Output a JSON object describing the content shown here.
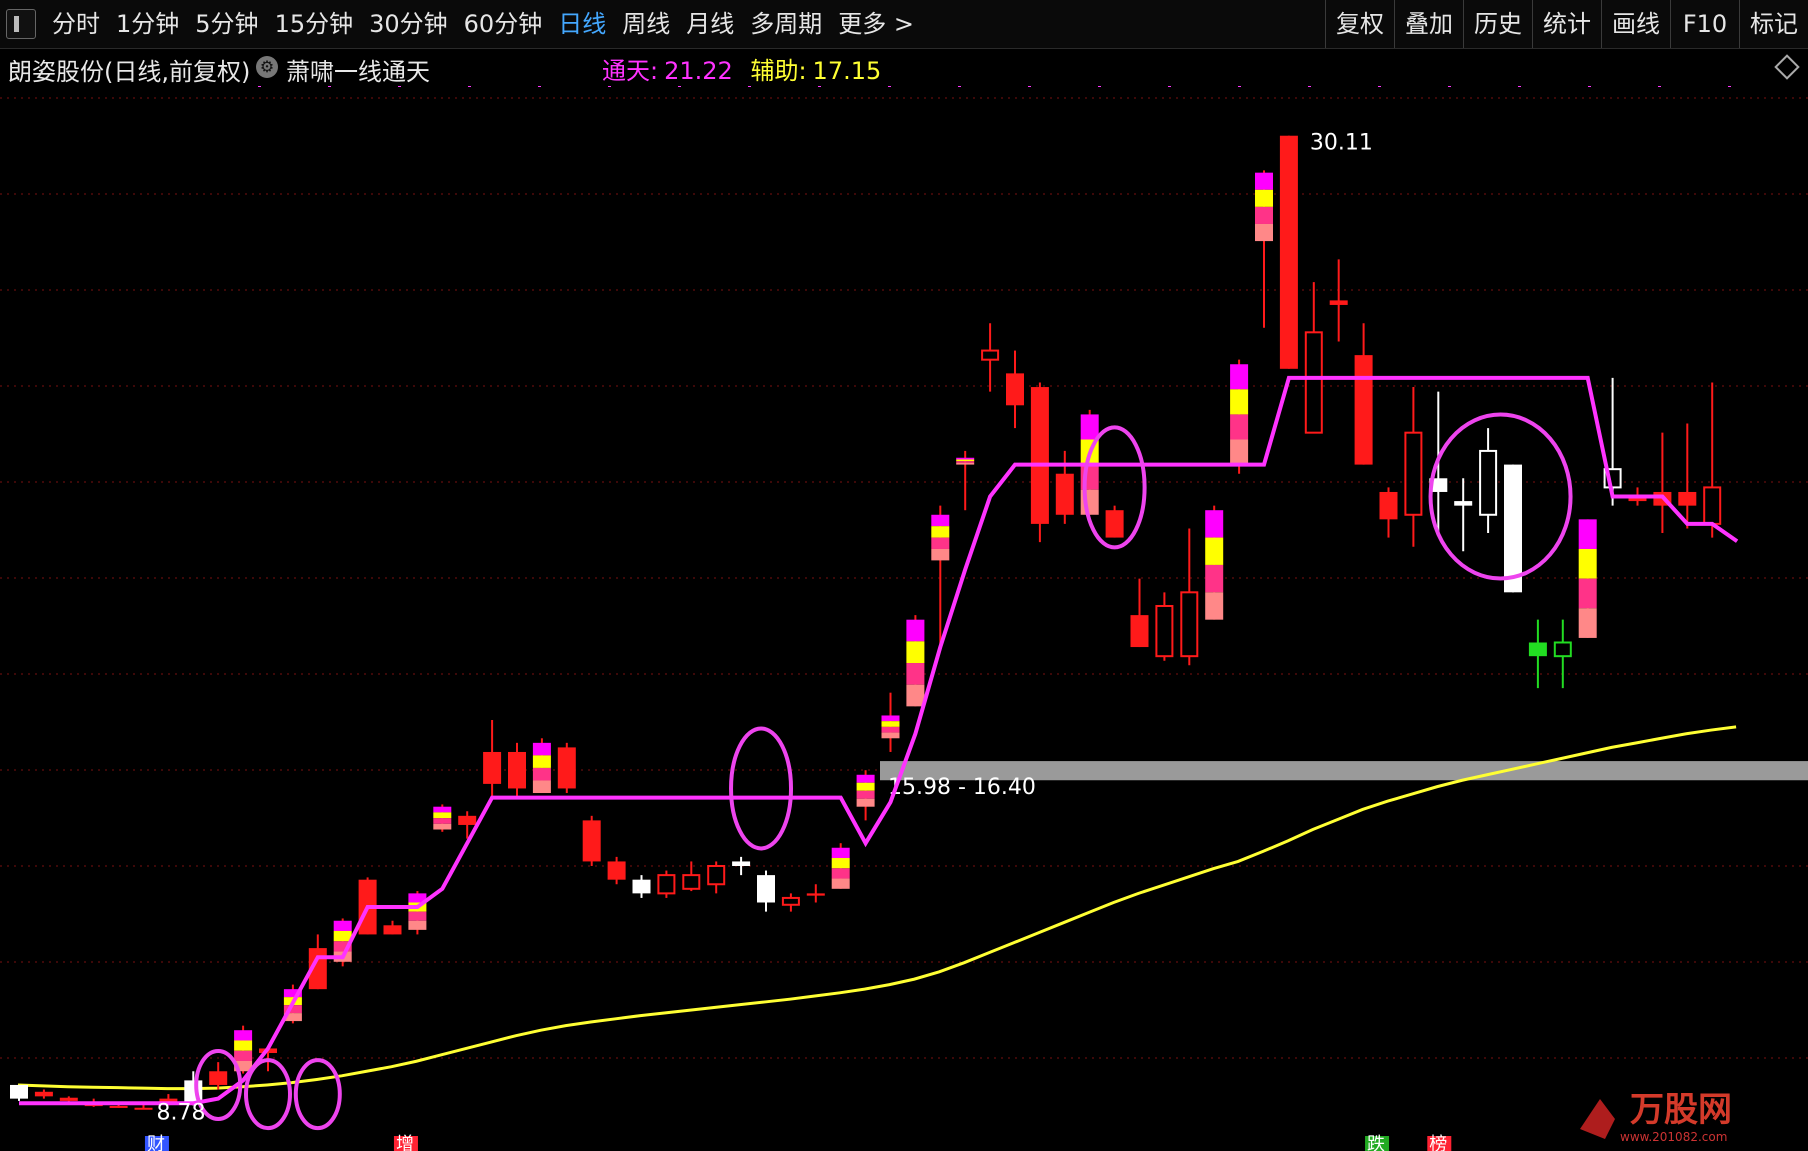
{
  "toolbar": {
    "periods": [
      "分时",
      "1分钟",
      "5分钟",
      "15分钟",
      "30分钟",
      "60分钟",
      "日线",
      "周线",
      "月线",
      "多周期",
      "更多 >"
    ],
    "active_period": "日线",
    "actions": [
      "复权",
      "叠加",
      "历史",
      "统计",
      "画线",
      "F10",
      "标记"
    ]
  },
  "info": {
    "title": "朗姿股份(日线,前复权)",
    "indicator_name": "萧啸一线通天",
    "tongtian_label": "通天:",
    "tongtian_value": "21.22",
    "fuzhu_label": "辅助:",
    "fuzhu_value": "17.15"
  },
  "colors": {
    "up": "#ff1a1a",
    "down": "#ffffff",
    "tongtian_line": "#ff33ff",
    "fuzhu_line": "#ffff33",
    "highlight_yellow": "#ffff00",
    "highlight_pink": "#ff3388",
    "highlight_salmon": "#ff8888",
    "grid": "#7a1010"
  },
  "chart_data": {
    "type": "candlestick",
    "y_range": [
      8.4,
      31.2
    ],
    "high_label": "30.11",
    "low_label": "8.78",
    "zone_label": "15.98 - 16.40",
    "zone": [
      15.98,
      16.4
    ],
    "markers": [
      "财",
      "增",
      "跌",
      "榜"
    ],
    "candles": [
      {
        "o": 9.0,
        "c": 9.3,
        "h": 9.3,
        "l": 8.95,
        "up": false,
        "hi": false,
        "tip": "white"
      },
      {
        "o": 9.05,
        "c": 9.15,
        "h": 9.2,
        "l": 9.0,
        "up": true,
        "hi": false,
        "tip": "green"
      },
      {
        "o": 8.95,
        "c": 9.02,
        "h": 9.05,
        "l": 8.92,
        "up": true,
        "hi": false,
        "tip": "green"
      },
      {
        "o": 8.85,
        "c": 8.88,
        "h": 9.0,
        "l": 8.82,
        "up": true,
        "hi": false,
        "tip": "green"
      },
      {
        "o": 8.82,
        "c": 8.84,
        "h": 8.88,
        "l": 8.8,
        "up": true,
        "hi": false,
        "tip": "green"
      },
      {
        "o": 8.79,
        "c": 8.8,
        "h": 8.86,
        "l": 8.78,
        "up": true,
        "hi": false,
        "tip": "green"
      },
      {
        "o": 8.9,
        "c": 9.0,
        "h": 9.1,
        "l": 8.85,
        "up": true,
        "hi": false,
        "tip": "green"
      },
      {
        "o": 9.4,
        "c": 8.9,
        "h": 9.6,
        "l": 8.85,
        "up": false,
        "hi": false,
        "tip": "white"
      },
      {
        "o": 9.3,
        "c": 9.6,
        "h": 9.8,
        "l": 9.2,
        "up": true,
        "hi": false,
        "tip": "red-hollow"
      },
      {
        "o": 9.6,
        "c": 10.5,
        "h": 10.6,
        "l": 9.55,
        "up": true,
        "hi": true
      },
      {
        "o": 10.1,
        "c": 10.0,
        "h": 10.1,
        "l": 9.6,
        "up": true,
        "hi": false,
        "tip": "arrow"
      },
      {
        "o": 10.7,
        "c": 11.4,
        "h": 11.5,
        "l": 10.65,
        "up": true,
        "hi": true
      },
      {
        "o": 11.4,
        "c": 12.3,
        "h": 12.6,
        "l": 11.4,
        "up": true,
        "hi": false
      },
      {
        "o": 12.0,
        "c": 12.9,
        "h": 12.95,
        "l": 11.9,
        "up": true,
        "hi": true
      },
      {
        "o": 12.6,
        "c": 13.8,
        "h": 13.85,
        "l": 12.6,
        "up": true,
        "hi": false
      },
      {
        "o": 12.6,
        "c": 12.8,
        "h": 12.9,
        "l": 12.6,
        "up": true,
        "hi": false
      },
      {
        "o": 12.7,
        "c": 13.5,
        "h": 13.55,
        "l": 12.6,
        "up": true,
        "hi": true
      },
      {
        "o": 14.9,
        "c": 15.4,
        "h": 15.45,
        "l": 14.85,
        "up": true,
        "hi": true
      },
      {
        "o": 15.0,
        "c": 15.2,
        "h": 15.3,
        "l": 14.7,
        "up": true,
        "hi": false
      },
      {
        "o": 15.9,
        "c": 16.6,
        "h": 17.3,
        "l": 15.6,
        "up": true,
        "hi": false
      },
      {
        "o": 15.8,
        "c": 16.6,
        "h": 16.8,
        "l": 15.6,
        "up": true,
        "hi": false
      },
      {
        "o": 15.7,
        "c": 16.8,
        "h": 16.9,
        "l": 15.7,
        "up": true,
        "hi": true
      },
      {
        "o": 16.7,
        "c": 15.8,
        "h": 16.8,
        "l": 15.7,
        "up": true,
        "hi": false
      },
      {
        "o": 15.1,
        "c": 14.2,
        "h": 15.2,
        "l": 14.1,
        "up": true,
        "hi": false
      },
      {
        "o": 14.2,
        "c": 13.8,
        "h": 14.3,
        "l": 13.7,
        "up": true,
        "hi": false
      },
      {
        "o": 13.8,
        "c": 13.5,
        "h": 13.9,
        "l": 13.4,
        "up": false,
        "hi": false
      },
      {
        "o": 13.5,
        "c": 13.9,
        "h": 14.0,
        "l": 13.4,
        "up": true,
        "hi": false,
        "hollow": true
      },
      {
        "o": 13.6,
        "c": 13.9,
        "h": 14.2,
        "l": 13.55,
        "up": true,
        "hi": false,
        "hollow": true
      },
      {
        "o": 13.7,
        "c": 14.1,
        "h": 14.2,
        "l": 13.5,
        "up": true,
        "hi": false,
        "hollow": true
      },
      {
        "o": 14.1,
        "c": 14.2,
        "h": 14.3,
        "l": 13.9,
        "up": false,
        "hi": false
      },
      {
        "o": 13.9,
        "c": 13.3,
        "h": 14.0,
        "l": 13.1,
        "up": false,
        "hi": false
      },
      {
        "o": 13.25,
        "c": 13.4,
        "h": 13.5,
        "l": 13.1,
        "up": true,
        "hi": false,
        "hollow": true
      },
      {
        "o": 13.45,
        "c": 13.5,
        "h": 13.7,
        "l": 13.3,
        "up": true,
        "hi": false,
        "tip": "green"
      },
      {
        "o": 13.6,
        "c": 14.5,
        "h": 14.6,
        "l": 13.6,
        "up": true,
        "hi": true
      },
      {
        "o": 15.4,
        "c": 16.1,
        "h": 16.2,
        "l": 15.1,
        "up": true,
        "hi": true
      },
      {
        "o": 16.9,
        "c": 17.4,
        "h": 17.9,
        "l": 16.6,
        "up": true,
        "hi": true
      },
      {
        "o": 17.6,
        "c": 19.5,
        "h": 19.6,
        "l": 17.6,
        "up": true,
        "hi": true
      },
      {
        "o": 20.8,
        "c": 21.8,
        "h": 22.0,
        "l": 18.9,
        "up": true,
        "hi": true
      },
      {
        "o": 22.9,
        "c": 23.05,
        "h": 23.2,
        "l": 21.9,
        "up": true,
        "hi": true
      },
      {
        "o": 25.2,
        "c": 25.4,
        "h": 26.0,
        "l": 24.5,
        "up": true,
        "hi": false,
        "hollow": true
      },
      {
        "o": 24.2,
        "c": 24.9,
        "h": 25.4,
        "l": 23.7,
        "up": true,
        "hi": false
      },
      {
        "o": 21.6,
        "c": 24.6,
        "h": 24.7,
        "l": 21.2,
        "up": true,
        "hi": false
      },
      {
        "o": 21.8,
        "c": 22.7,
        "h": 23.2,
        "l": 21.6,
        "up": true,
        "hi": false
      },
      {
        "o": 21.8,
        "c": 24.0,
        "h": 24.1,
        "l": 21.8,
        "up": true,
        "hi": true
      },
      {
        "o": 21.3,
        "c": 21.9,
        "h": 22.0,
        "l": 21.3,
        "up": true,
        "hi": false
      },
      {
        "o": 18.9,
        "c": 19.6,
        "h": 20.4,
        "l": 18.9,
        "up": true,
        "hi": false
      },
      {
        "o": 18.7,
        "c": 19.8,
        "h": 20.1,
        "l": 18.6,
        "up": true,
        "hi": false,
        "hollow": true
      },
      {
        "o": 18.7,
        "c": 20.1,
        "h": 21.5,
        "l": 18.5,
        "up": true,
        "hi": false,
        "hollow": true
      },
      {
        "o": 19.5,
        "c": 21.9,
        "h": 22.0,
        "l": 19.5,
        "up": true,
        "hi": true
      },
      {
        "o": 22.9,
        "c": 25.1,
        "h": 25.2,
        "l": 22.7,
        "up": true,
        "hi": true
      },
      {
        "o": 27.8,
        "c": 29.3,
        "h": 29.35,
        "l": 25.9,
        "up": true,
        "hi": true
      },
      {
        "o": 25.0,
        "c": 30.11,
        "h": 30.11,
        "l": 25.0,
        "up": true,
        "hi": false
      },
      {
        "o": 23.6,
        "c": 25.8,
        "h": 26.9,
        "l": 23.6,
        "up": true,
        "hi": false,
        "hollow": true
      },
      {
        "o": 26.4,
        "c": 26.5,
        "h": 27.4,
        "l": 25.6,
        "up": true,
        "hi": false
      },
      {
        "o": 22.9,
        "c": 25.3,
        "h": 26.0,
        "l": 22.9,
        "up": true,
        "hi": false
      },
      {
        "o": 21.7,
        "c": 22.3,
        "h": 22.4,
        "l": 21.3,
        "up": true,
        "hi": false
      },
      {
        "o": 21.8,
        "c": 23.6,
        "h": 24.6,
        "l": 21.1,
        "up": true,
        "hi": false,
        "hollow": true
      },
      {
        "o": 22.6,
        "c": 22.3,
        "h": 24.5,
        "l": 21.4,
        "up": false,
        "hi": false
      },
      {
        "o": 22.1,
        "c": 22.0,
        "h": 22.6,
        "l": 21.0,
        "up": false,
        "hi": false
      },
      {
        "o": 23.2,
        "c": 21.8,
        "h": 23.7,
        "l": 21.4,
        "up": false,
        "hi": false,
        "hollow": true
      },
      {
        "o": 22.9,
        "c": 20.1,
        "h": 22.9,
        "l": 20.1,
        "up": false,
        "hi": false
      },
      {
        "o": 19.0,
        "c": 18.7,
        "h": 19.5,
        "l": 18.0,
        "up": false,
        "hi": false,
        "green": true
      },
      {
        "o": 18.7,
        "c": 19.0,
        "h": 19.5,
        "l": 18.0,
        "up": false,
        "hi": false,
        "green": true,
        "hollow": true
      },
      {
        "o": 19.1,
        "c": 21.7,
        "h": 21.7,
        "l": 19.1,
        "up": true,
        "hi": true
      },
      {
        "o": 22.8,
        "c": 22.4,
        "h": 24.8,
        "l": 22.0,
        "up": false,
        "hi": false,
        "hollow": true
      },
      {
        "o": 22.2,
        "c": 22.1,
        "h": 22.4,
        "l": 22.0,
        "up": true,
        "hi": false
      },
      {
        "o": 22.0,
        "c": 22.3,
        "h": 23.6,
        "l": 21.4,
        "up": true,
        "hi": false
      },
      {
        "o": 22.0,
        "c": 22.3,
        "h": 23.8,
        "l": 21.5,
        "up": true,
        "hi": false
      },
      {
        "o": 21.6,
        "c": 22.4,
        "h": 24.7,
        "l": 21.3,
        "up": true,
        "hi": false,
        "hollow": true
      }
    ],
    "series": [
      {
        "name": "通天",
        "values": [
          8.9,
          8.9,
          8.9,
          8.9,
          8.9,
          8.9,
          8.9,
          8.9,
          9.0,
          9.4,
          10.1,
          11.1,
          12.1,
          12.1,
          13.2,
          13.2,
          13.2,
          13.6,
          14.6,
          15.6,
          15.6,
          15.6,
          15.6,
          15.6,
          15.6,
          15.6,
          15.6,
          15.6,
          15.6,
          15.6,
          15.6,
          15.6,
          15.6,
          15.6,
          14.6,
          15.5,
          17.0,
          18.9,
          20.6,
          22.2,
          22.9,
          22.9,
          22.9,
          22.9,
          22.9,
          22.9,
          22.9,
          22.9,
          22.9,
          22.9,
          22.9,
          24.8,
          24.8,
          24.8,
          24.8,
          24.8,
          24.8,
          24.8,
          24.8,
          24.8,
          24.8,
          24.8,
          24.8,
          24.8,
          22.2,
          22.2,
          22.2,
          21.6,
          21.6,
          21.22
        ]
      },
      {
        "name": "辅助",
        "values": [
          9.3,
          9.28,
          9.26,
          9.25,
          9.24,
          9.23,
          9.22,
          9.22,
          9.23,
          9.26,
          9.3,
          9.35,
          9.42,
          9.5,
          9.6,
          9.7,
          9.82,
          9.96,
          10.1,
          10.24,
          10.38,
          10.5,
          10.6,
          10.68,
          10.75,
          10.82,
          10.88,
          10.94,
          11.0,
          11.06,
          11.12,
          11.18,
          11.25,
          11.32,
          11.4,
          11.5,
          11.62,
          11.78,
          11.98,
          12.2,
          12.42,
          12.64,
          12.86,
          13.08,
          13.3,
          13.5,
          13.68,
          13.86,
          14.04,
          14.2,
          14.42,
          14.65,
          14.9,
          15.12,
          15.34,
          15.52,
          15.68,
          15.84,
          15.98,
          16.1,
          16.22,
          16.34,
          16.46,
          16.58,
          16.7,
          16.8,
          16.9,
          17.0,
          17.08,
          17.15
        ]
      }
    ]
  }
}
